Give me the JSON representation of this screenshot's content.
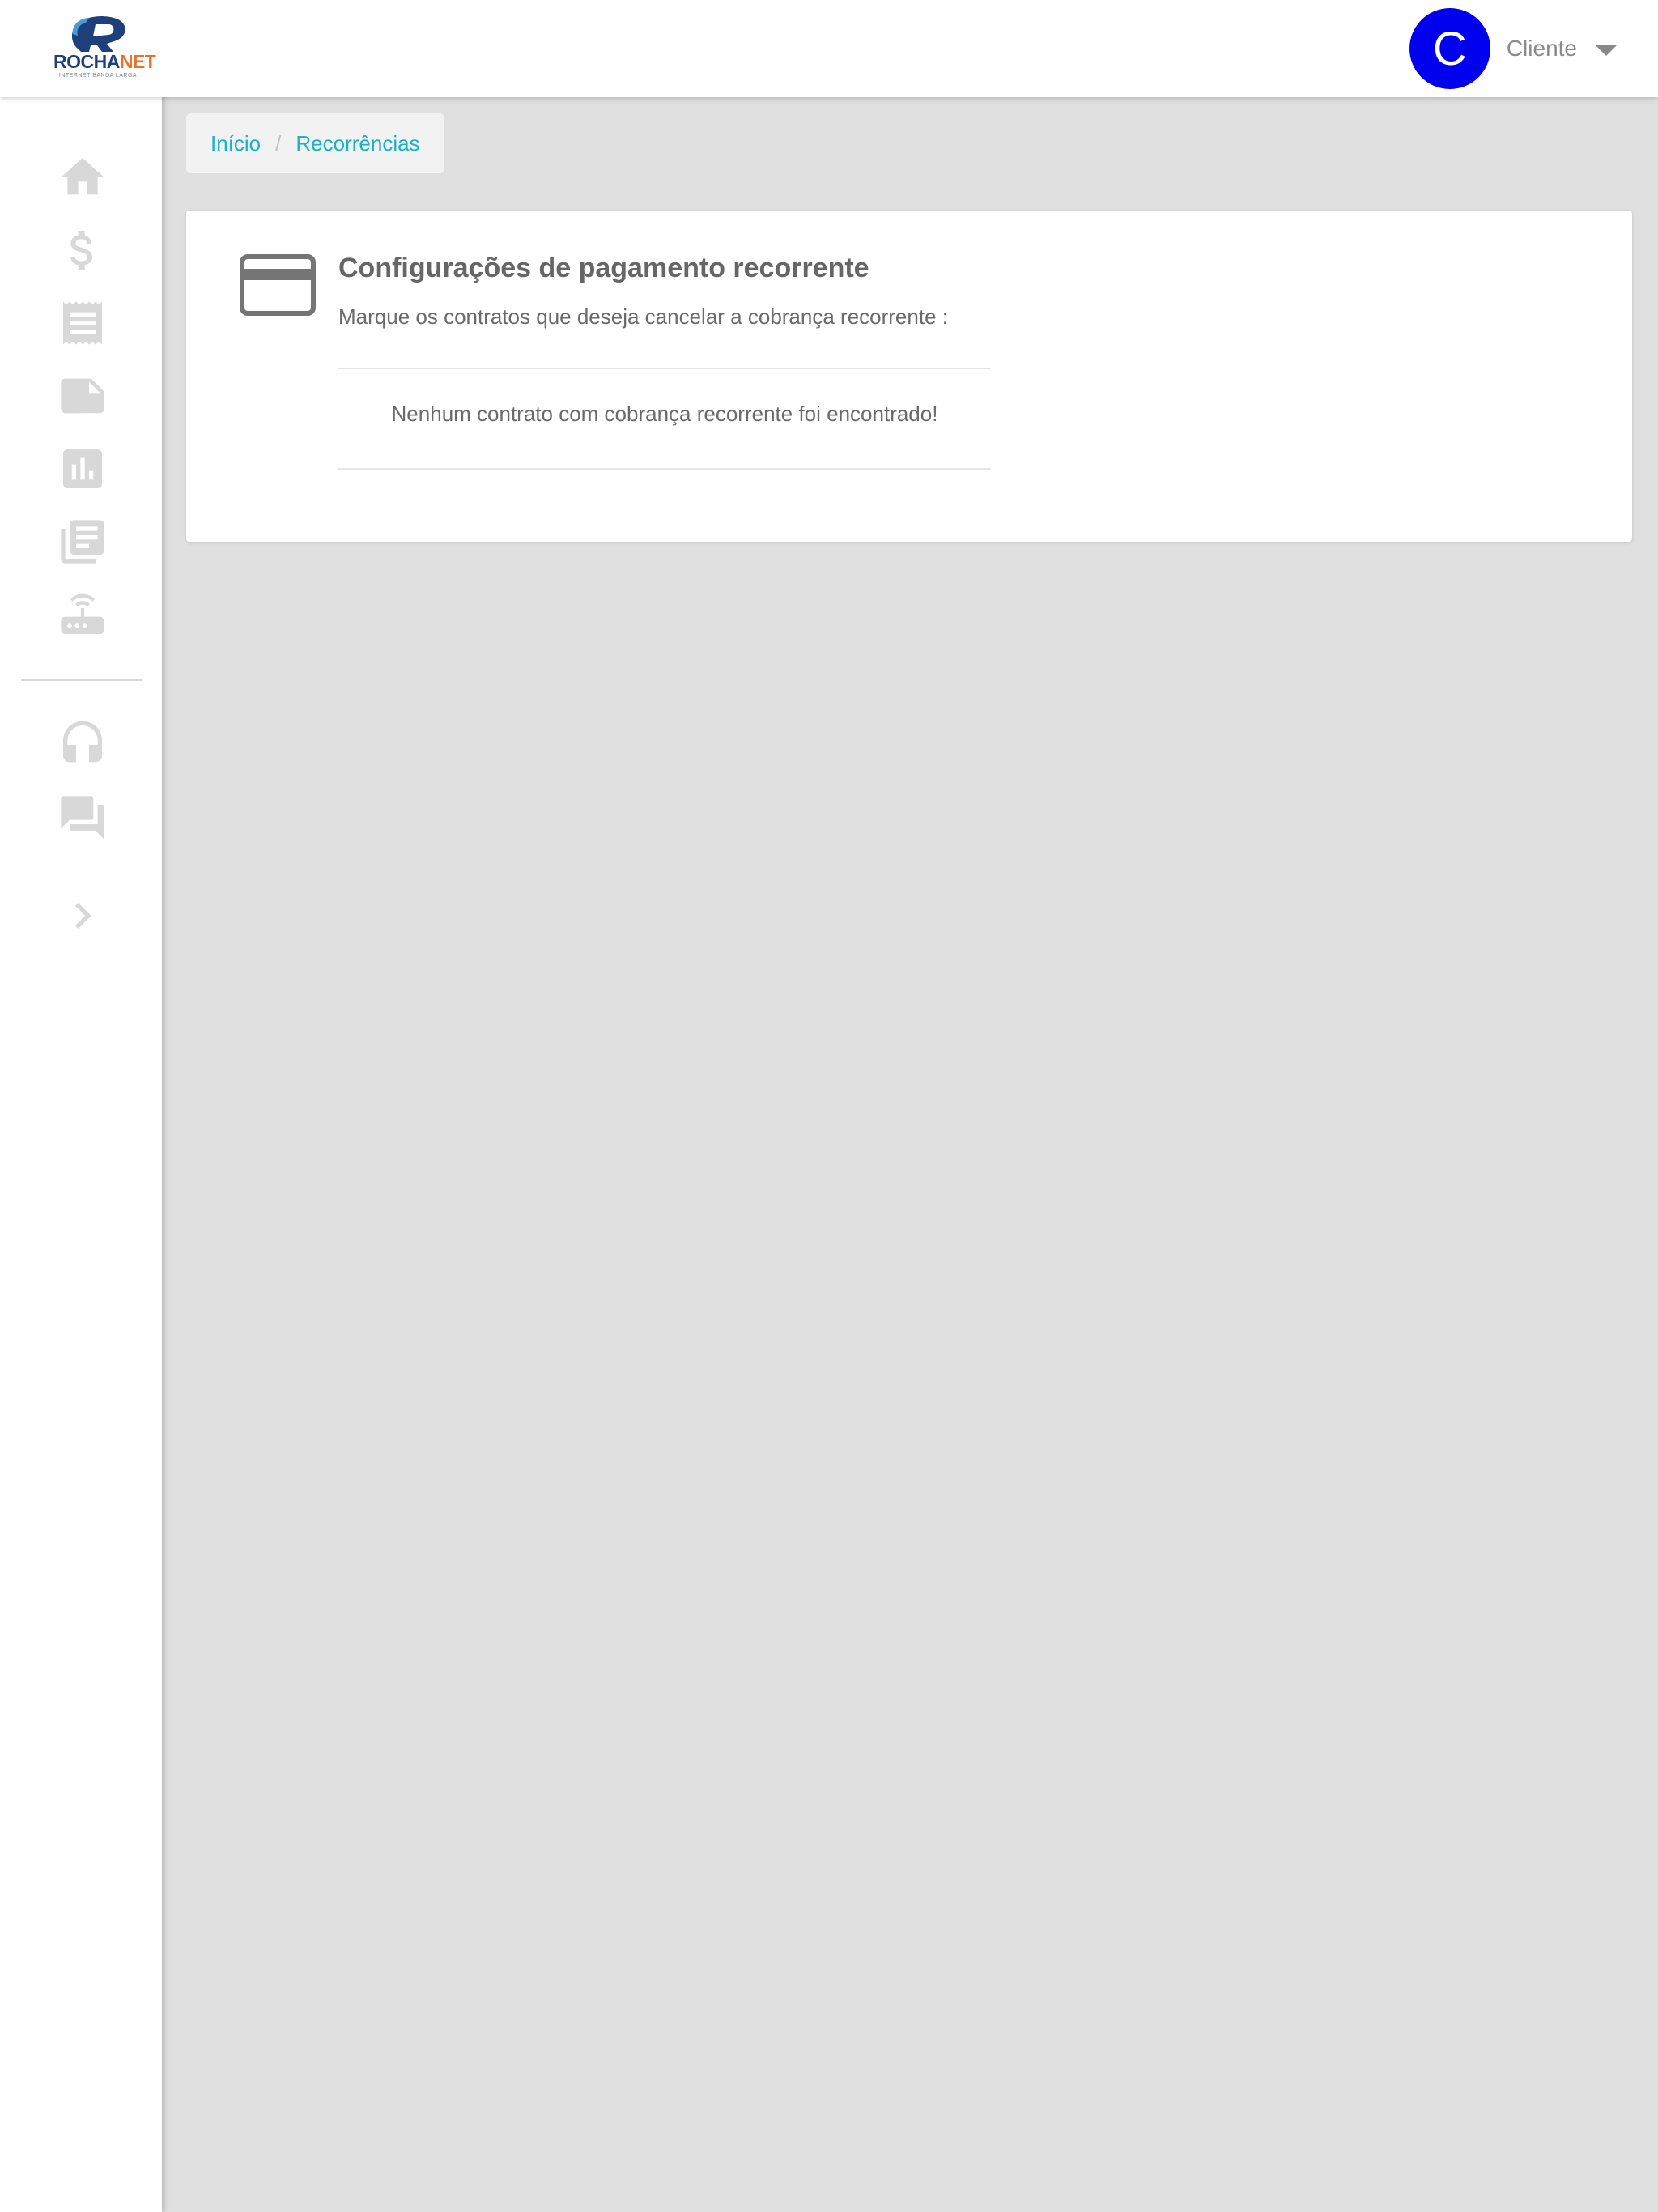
{
  "brand": {
    "name_part1": "ROCHA",
    "name_part2": "NET",
    "tagline": "INTERNET BANDA LARGA",
    "color_primary": "#1d3f7a",
    "color_accent": "#e8722a"
  },
  "header": {
    "avatar_initial": "C",
    "avatar_color": "#0000ee",
    "user_name": "Cliente",
    "menu_icon": "caret-down-icon"
  },
  "sidebar": {
    "items": [
      {
        "icon": "home-icon"
      },
      {
        "icon": "dollar-icon"
      },
      {
        "icon": "receipt-icon"
      },
      {
        "icon": "note-icon"
      },
      {
        "icon": "bar-chart-icon"
      },
      {
        "icon": "library-books-icon"
      },
      {
        "icon": "router-icon"
      },
      {
        "icon": "headset-icon"
      },
      {
        "icon": "forum-icon"
      },
      {
        "icon": "chevron-right-icon"
      }
    ]
  },
  "breadcrumb": {
    "items": [
      "Início",
      "Recorrências"
    ],
    "separator": "/",
    "link_color": "#1ab2c7"
  },
  "card": {
    "icon": "credit-card-icon",
    "title": "Configurações de pagamento recorrente",
    "subtitle": "Marque os contratos que deseja cancelar a cobrança recorrente :",
    "empty_message": "Nenhum contrato com cobrança recorrente foi encontrado!"
  }
}
